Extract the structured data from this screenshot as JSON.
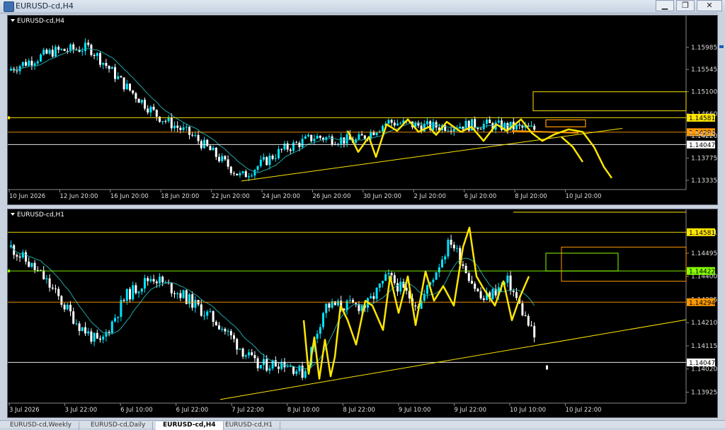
{
  "window": {
    "title": "EURUSD-cd,H4",
    "min": "▁",
    "max": "❐",
    "close": "✕"
  },
  "colors": {
    "bull": "#00e5ff",
    "bear": "#ffffff",
    "ma": "#22a6a6",
    "yellow": "#ffe600",
    "orange": "#ff9900",
    "lime": "#88ff00",
    "grid": "#ffffff"
  },
  "chart1": {
    "label": "EURUSD-cd,H4",
    "ylim": [
      1.1315,
      1.1645
    ],
    "yticks": [
      "1.15985",
      "1.15545",
      "1.15100",
      "1.14660",
      "1.14220",
      "1.13775",
      "1.13335"
    ],
    "ytick_values": [
      1.15985,
      1.15545,
      1.151,
      1.1466,
      1.1422,
      1.13775,
      1.13335
    ],
    "xticks": [
      "10 Jun 2026",
      "12 Jun 20:00",
      "16 Jun 20:00",
      "18 Jun 20:00",
      "22 Jun 20:00",
      "24 Jun 20:00",
      "26 Jun 20:00",
      "30 Jun 20:00",
      "2 Jul 20:00",
      "6 Jul 20:00",
      "8 Jul 20:00",
      "10 Jul 20:00"
    ],
    "hlines": [
      {
        "price": 1.14581,
        "label": "1.14581",
        "color": "#ffe600"
      },
      {
        "price": 1.14294,
        "label": "1.14294",
        "color": "#ff9900"
      },
      {
        "price": 1.14047,
        "label": "1.14047",
        "color": "#ffffff"
      }
    ],
    "overlap_label": "1.14220"
  },
  "chart2": {
    "label": "EURUSD-cd,H1",
    "ylim": [
      1.1388,
      1.1464
    ],
    "yticks": [
      "1.14581",
      "1.14495",
      "1.14400",
      "1.14305",
      "1.14210",
      "1.14115",
      "1.14020",
      "1.13925"
    ],
    "ytick_values": [
      1.14581,
      1.14495,
      1.144,
      1.14305,
      1.1421,
      1.14115,
      1.1402,
      1.13925
    ],
    "xticks": [
      "3 Jul 2026",
      "3 Jul 22:00",
      "6 Jul 10:00",
      "6 Jul 22:00",
      "7 Jul 22:00",
      "8 Jul 10:00",
      "8 Jul 22:00",
      "9 Jul 10:00",
      "9 Jul 22:00",
      "10 Jul 10:00",
      "10 Jul 22:00"
    ],
    "hlines": [
      {
        "price": 1.14581,
        "label": "1.14581",
        "color": "#ffe600"
      },
      {
        "price": 1.14422,
        "label": "1.14422",
        "color": "#88ff00"
      },
      {
        "price": 1.14294,
        "label": "1.14294",
        "color": "#ff9900"
      },
      {
        "price": 1.14047,
        "label": "1.14047",
        "color": "#ffffff"
      }
    ]
  },
  "tabs": [
    "EURUSD-cd,Weekly",
    "EURUSD-cd,Daily",
    "EURUSD-cd,H4",
    "EURUSD-cd,H1"
  ],
  "active_tab": 2
}
